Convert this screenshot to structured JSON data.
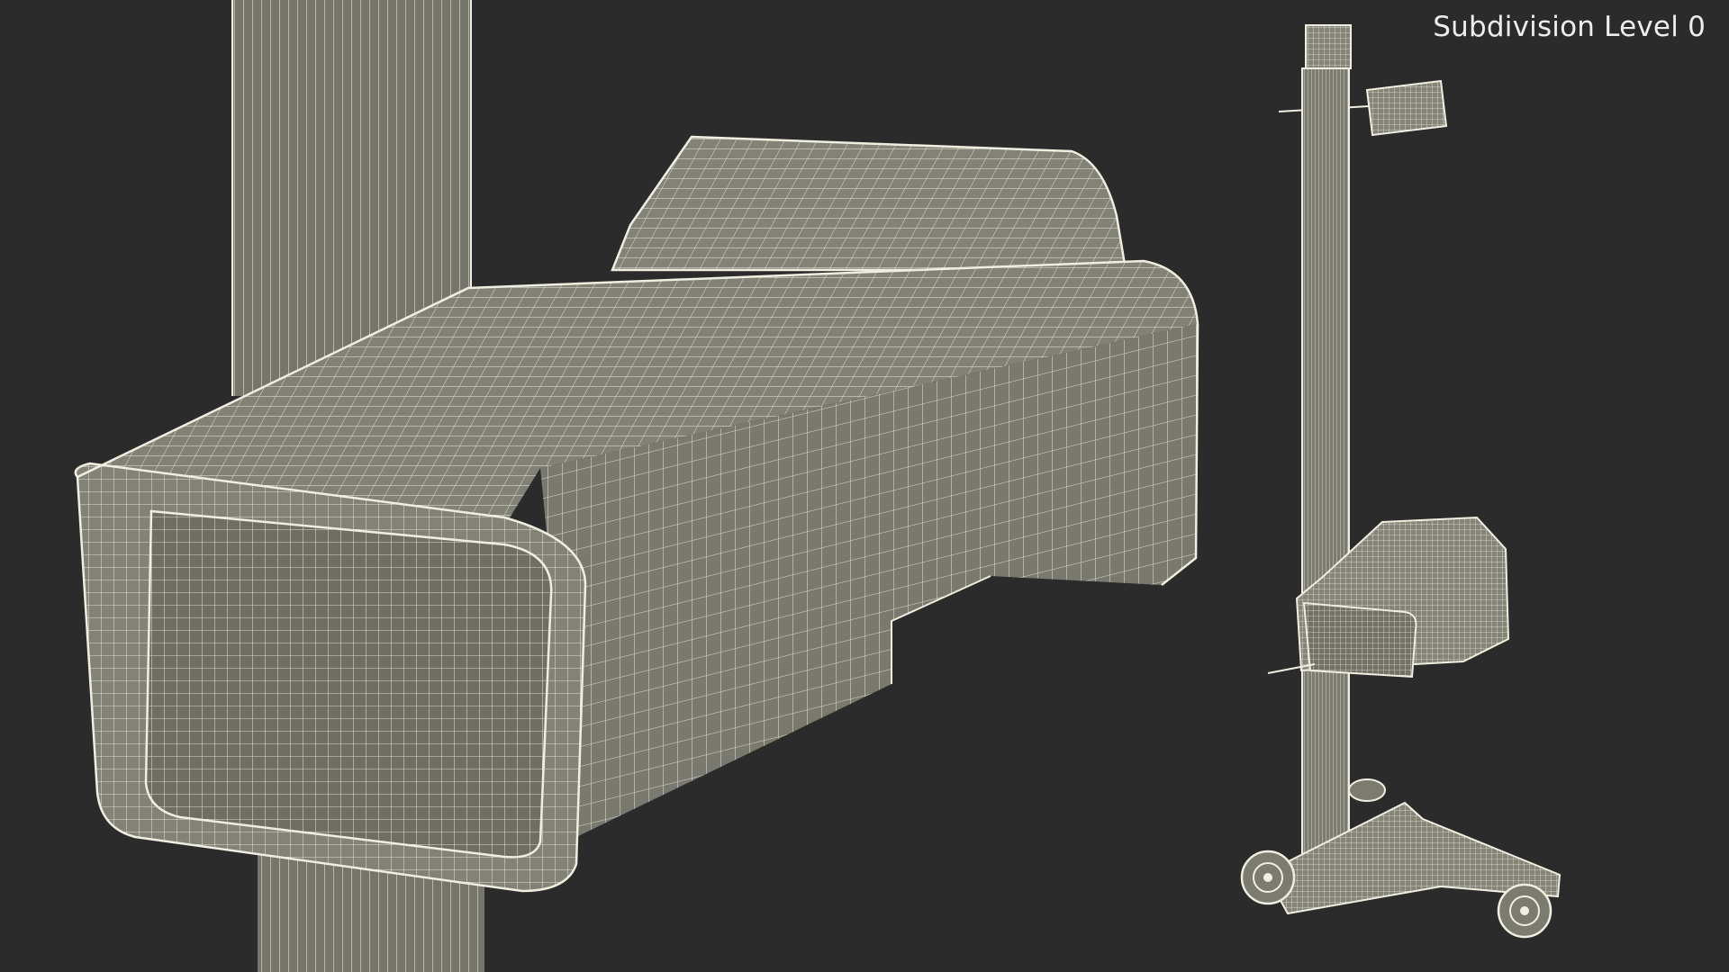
{
  "viewport": {
    "overlay_label": "Subdivision Level 0",
    "background_color": "#2b2b2b"
  },
  "scene": {
    "description_icon": "wireframe-headlight-tester-render",
    "wire_color": "#efeee0",
    "surface_color": "#7d7c71"
  }
}
